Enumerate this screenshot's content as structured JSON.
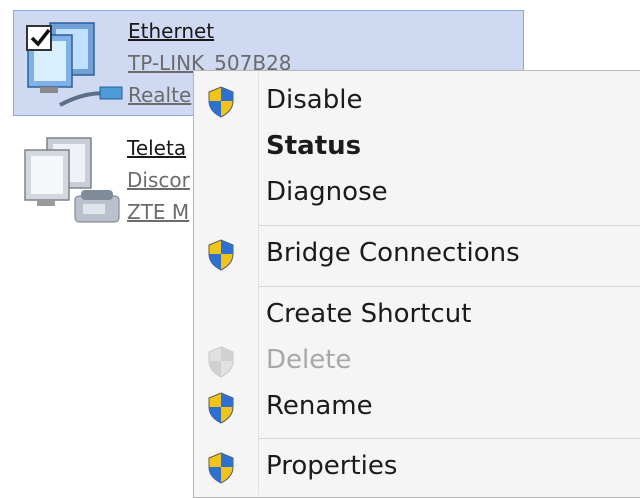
{
  "connections": [
    {
      "name": "Ethernet",
      "network": "TP-LINK_507B28",
      "adapter": "Realte",
      "checked": true,
      "icon": "ethernet-adapter-icon"
    },
    {
      "name": "Teleta",
      "network": "Discor",
      "adapter": "ZTE M",
      "icon": "dialup-modem-icon"
    }
  ],
  "context_menu": {
    "items": [
      {
        "label": "Disable",
        "icon": "uac-shield-icon",
        "enabled": true
      },
      {
        "label": "Status",
        "bold": true,
        "enabled": true
      },
      {
        "label": "Diagnose",
        "enabled": true
      },
      {
        "label": "Bridge Connections",
        "icon": "uac-shield-icon",
        "enabled": true
      },
      {
        "label": "Create Shortcut",
        "enabled": true
      },
      {
        "label": "Delete",
        "icon": "uac-shield-icon",
        "enabled": false
      },
      {
        "label": "Rename",
        "icon": "uac-shield-icon",
        "enabled": true
      },
      {
        "label": "Properties",
        "icon": "uac-shield-icon",
        "enabled": true
      }
    ]
  },
  "colors": {
    "selection_bg": "#cfd9f1",
    "selection_border": "#8aa7e0",
    "menu_bg": "#f5f5f5",
    "disabled_text": "#a8a8a8"
  }
}
